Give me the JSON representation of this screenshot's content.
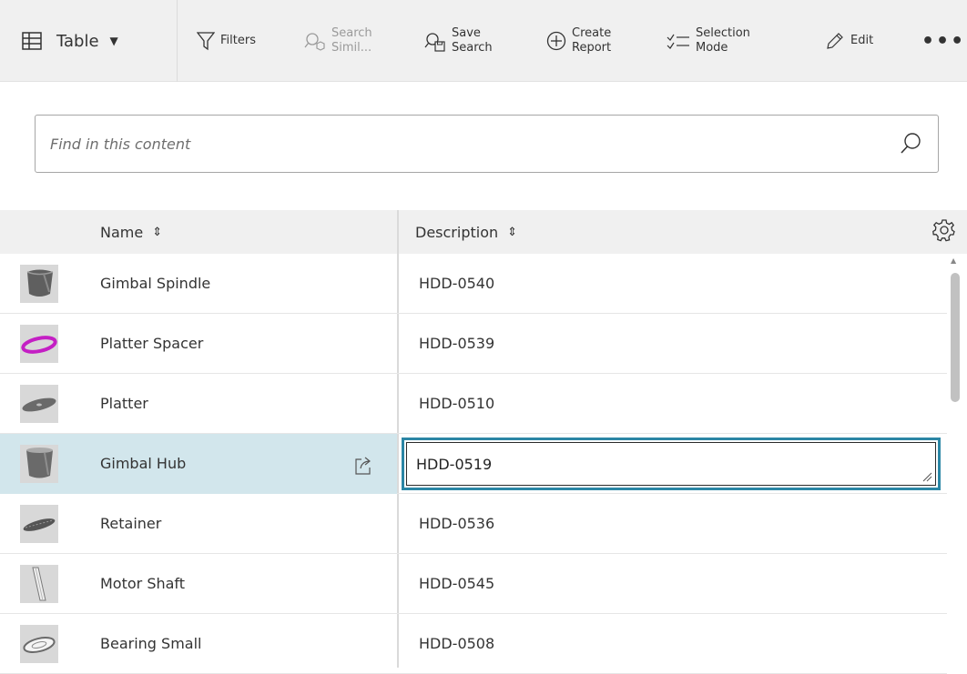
{
  "toolbar": {
    "view_label": "Table",
    "filters_label": "Filters",
    "search_similar_line1": "Search",
    "search_similar_line2": "Simil...",
    "save_search_line1": "Save",
    "save_search_line2": "Search",
    "create_report_line1": "Create",
    "create_report_line2": "Report",
    "selection_mode_line1": "Selection",
    "selection_mode_line2": "Mode",
    "edit_label": "Edit",
    "more_label": "•••"
  },
  "search": {
    "placeholder": "Find in this content",
    "value": ""
  },
  "table": {
    "columns": [
      {
        "label": "Name",
        "sort_glyph": "⇕"
      },
      {
        "label": "Description",
        "sort_glyph": "⇕"
      }
    ],
    "rows": [
      {
        "name": "Gimbal Spindle",
        "description": "HDD-0540",
        "thumbnail": "spindle-part-icon"
      },
      {
        "name": "Platter Spacer",
        "description": "HDD-0539",
        "thumbnail": "ring-part-icon"
      },
      {
        "name": "Platter",
        "description": "HDD-0510",
        "thumbnail": "disk-part-icon"
      },
      {
        "name": "Gimbal Hub",
        "description": "HDD-0519",
        "thumbnail": "hub-part-icon",
        "selected": true,
        "editing": true
      },
      {
        "name": "Retainer",
        "description": "HDD-0536",
        "thumbnail": "retainer-part-icon"
      },
      {
        "name": "Motor Shaft",
        "description": "HDD-0545",
        "thumbnail": "shaft-part-icon"
      },
      {
        "name": "Bearing Small",
        "description": "HDD-0508",
        "thumbnail": "bearing-part-icon"
      }
    ]
  },
  "colors": {
    "toolbar_bg": "#f0f0f0",
    "selected_row_bg": "#d2e6ec",
    "edit_border": "#2b86a5",
    "ring_part": "#c41fc4"
  }
}
